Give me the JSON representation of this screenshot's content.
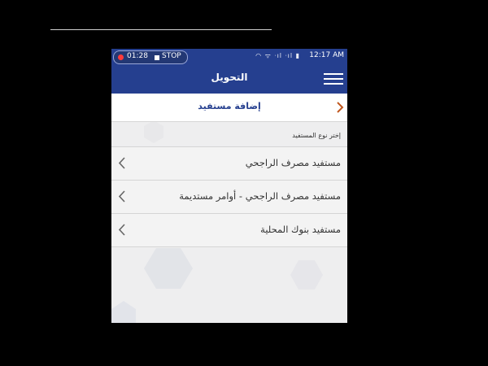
{
  "statusbar": {
    "record_time": "01:28",
    "stop_label": "STOP",
    "clock": "12:17 AM",
    "icons": "◠ ᯤ ᐧıl ᐧıl ▮"
  },
  "appbar": {
    "title": "التحويل"
  },
  "add_beneficiary": {
    "label": "إضافة مستفيد"
  },
  "section": {
    "label": "إختر نوع المستفيد"
  },
  "beneficiary_types": [
    {
      "label": "مستفيد مصرف الراجحي"
    },
    {
      "label": "مستفيد مصرف الراجحي - أوامر مستديمة"
    },
    {
      "label": "مستفيد بنوك المحلية"
    }
  ],
  "colors": {
    "brand_blue": "#253f8f",
    "accent_orange": "#c0571e"
  }
}
